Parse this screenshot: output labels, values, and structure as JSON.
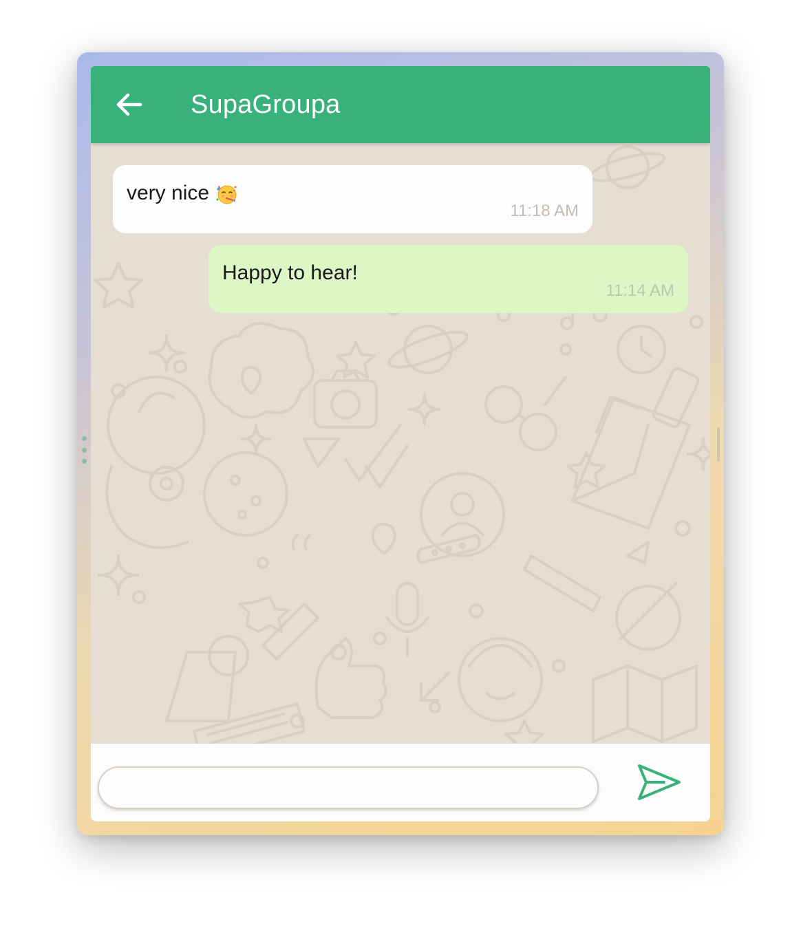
{
  "header": {
    "title": "SupaGroupa",
    "back_icon": "arrow-left-icon"
  },
  "messages": [
    {
      "direction": "incoming",
      "text": "very nice",
      "emoji": "partying-face",
      "time": "11:18 AM"
    },
    {
      "direction": "outgoing",
      "text": "Happy to hear!",
      "time": "11:14 AM"
    }
  ],
  "composer": {
    "value": "",
    "placeholder": "",
    "send_icon": "send-icon"
  },
  "colors": {
    "header": "#38b17a",
    "chat_background": "#e6ddd3",
    "incoming_bubble": "#fdfdfd",
    "outgoing_bubble": "#dcf6c6",
    "accent": "#38b17a"
  }
}
